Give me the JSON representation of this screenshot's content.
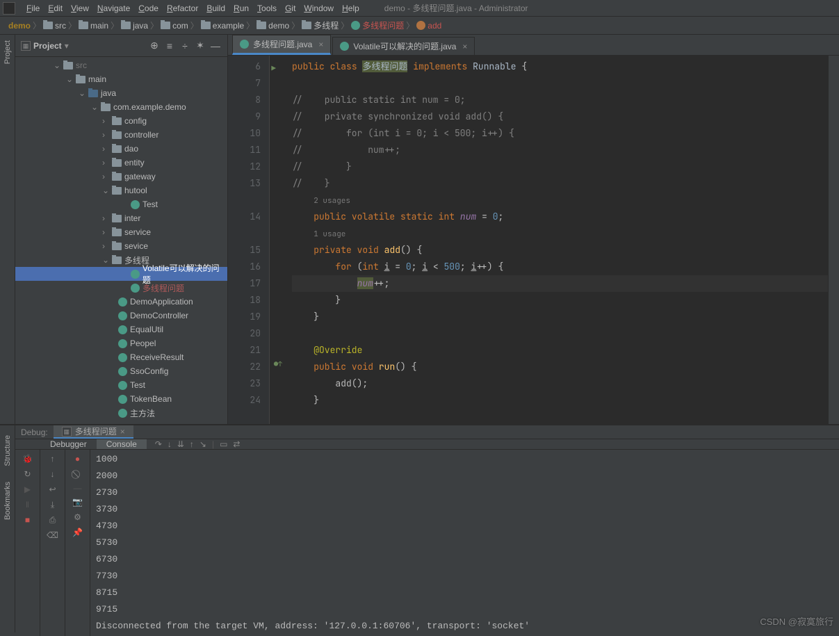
{
  "window_title": "demo - 多线程问题.java - Administrator",
  "menu": [
    "File",
    "Edit",
    "View",
    "Navigate",
    "Code",
    "Refactor",
    "Build",
    "Run",
    "Tools",
    "Git",
    "Window",
    "Help"
  ],
  "breadcrumbs": [
    {
      "label": "demo",
      "kind": "root"
    },
    {
      "label": "src",
      "kind": "folder"
    },
    {
      "label": "main",
      "kind": "folder"
    },
    {
      "label": "java",
      "kind": "folder"
    },
    {
      "label": "com",
      "kind": "folder"
    },
    {
      "label": "example",
      "kind": "folder"
    },
    {
      "label": "demo",
      "kind": "folder"
    },
    {
      "label": "多线程",
      "kind": "folder"
    },
    {
      "label": "多线程问题",
      "kind": "class"
    },
    {
      "label": "add",
      "kind": "method"
    }
  ],
  "project_header": "Project",
  "left_stripe_label": "Project",
  "tree": [
    {
      "indent": 55,
      "chev": "v",
      "icon": "folder",
      "label": "src",
      "dim": true
    },
    {
      "indent": 73,
      "chev": "v",
      "icon": "folder",
      "label": "main"
    },
    {
      "indent": 91,
      "chev": "v",
      "icon": "folder-blue",
      "label": "java"
    },
    {
      "indent": 109,
      "chev": "v",
      "icon": "folder",
      "label": "com.example.demo"
    },
    {
      "indent": 125,
      "chev": ">",
      "icon": "folder",
      "label": "config"
    },
    {
      "indent": 125,
      "chev": ">",
      "icon": "folder",
      "label": "controller"
    },
    {
      "indent": 125,
      "chev": ">",
      "icon": "folder",
      "label": "dao"
    },
    {
      "indent": 125,
      "chev": ">",
      "icon": "folder",
      "label": "entity"
    },
    {
      "indent": 125,
      "chev": ">",
      "icon": "folder",
      "label": "gateway"
    },
    {
      "indent": 125,
      "chev": "v",
      "icon": "folder",
      "label": "hutool"
    },
    {
      "indent": 152,
      "chev": "",
      "icon": "java",
      "label": "Test"
    },
    {
      "indent": 125,
      "chev": ">",
      "icon": "folder",
      "label": "inter"
    },
    {
      "indent": 125,
      "chev": ">",
      "icon": "folder",
      "label": "service"
    },
    {
      "indent": 125,
      "chev": ">",
      "icon": "folder",
      "label": "sevice"
    },
    {
      "indent": 125,
      "chev": "v",
      "icon": "folder",
      "label": "多线程"
    },
    {
      "indent": 152,
      "chev": "",
      "icon": "java",
      "label": "Volatile可以解决的问题",
      "selected": true
    },
    {
      "indent": 152,
      "chev": "",
      "icon": "java",
      "label": "多线程问题",
      "excluded": true
    },
    {
      "indent": 134,
      "chev": "",
      "icon": "java",
      "label": "DemoApplication"
    },
    {
      "indent": 134,
      "chev": "",
      "icon": "java",
      "label": "DemoController"
    },
    {
      "indent": 134,
      "chev": "",
      "icon": "java",
      "label": "EqualUtil"
    },
    {
      "indent": 134,
      "chev": "",
      "icon": "java",
      "label": "Peopel"
    },
    {
      "indent": 134,
      "chev": "",
      "icon": "java",
      "label": "ReceiveResult"
    },
    {
      "indent": 134,
      "chev": "",
      "icon": "java",
      "label": "SsoConfig"
    },
    {
      "indent": 134,
      "chev": "",
      "icon": "java",
      "label": "Test"
    },
    {
      "indent": 134,
      "chev": "",
      "icon": "java",
      "label": "TokenBean"
    },
    {
      "indent": 134,
      "chev": "",
      "icon": "java",
      "label": "主方法"
    }
  ],
  "tabs": [
    {
      "label": "多线程问题.java",
      "active": true
    },
    {
      "label": "Volatile可以解决的问题.java",
      "active": false
    }
  ],
  "gutter_start": 6,
  "code_lines": [
    {
      "n": 6,
      "run": true,
      "html": "<span class='kw'>public</span> <span class='kw'>class</span> <span class='hilite cls'>多线程问题</span> <span class='kw'>implements</span> <span class='cls'>Runnable</span> {"
    },
    {
      "n": 7,
      "html": ""
    },
    {
      "n": 8,
      "html": "<span class='com'>//    public static int num = 0;</span>"
    },
    {
      "n": 9,
      "html": "<span class='com'>//    private synchronized void add() {</span>"
    },
    {
      "n": 10,
      "html": "<span class='com'>//        for (int i = 0; i < 500; i++) {</span>"
    },
    {
      "n": 11,
      "html": "<span class='com'>//            num++;</span>"
    },
    {
      "n": 12,
      "html": "<span class='com'>//        }</span>"
    },
    {
      "n": 13,
      "html": "<span class='com'>//    }</span>"
    },
    {
      "n": 0,
      "inlay": "2 usages"
    },
    {
      "n": 14,
      "html": "    <span class='kw'>public</span> <span class='kw'>volatile</span> <span class='kw'>static</span> <span class='kw'>int</span> <span class='ident'>num</span> = <span class='num'>0</span>;"
    },
    {
      "n": 0,
      "inlay": "1 usage"
    },
    {
      "n": 15,
      "html": "    <span class='kw'>private</span> <span class='kw'>void</span> <span class='fn'>add</span>() {"
    },
    {
      "n": 16,
      "html": "        <span class='kw'>for</span> (<span class='kw'>int</span> <u>i</u> = <span class='num'>0</span>; <u>i</u> &lt; <span class='num'>500</span>; <u>i</u>++) {"
    },
    {
      "n": 17,
      "cur": true,
      "html": "            <span class='hilite ident'>num</span>++;"
    },
    {
      "n": 18,
      "html": "        }"
    },
    {
      "n": 19,
      "html": "    }"
    },
    {
      "n": 20,
      "html": ""
    },
    {
      "n": 21,
      "html": "    <span class='anno'>@Override</span>"
    },
    {
      "n": 22,
      "impl": true,
      "html": "    <span class='kw'>public</span> <span class='kw'>void</span> <span class='fn'>run</span>() {"
    },
    {
      "n": 23,
      "html": "        add();"
    },
    {
      "n": 24,
      "html": "    }"
    }
  ],
  "debug": {
    "label": "Debug:",
    "run_config": "多线程问题",
    "subtabs": [
      "Debugger",
      "Console"
    ],
    "active_subtab": "Console",
    "output": [
      "1000",
      "2000",
      "2730",
      "3730",
      "4730",
      "5730",
      "6730",
      "7730",
      "8715",
      "9715",
      "Disconnected from the target VM, address: '127.0.0.1:60706', transport: 'socket'"
    ]
  },
  "sidebar_bottom_labels": [
    "Structure",
    "Bookmarks"
  ],
  "watermark": "CSDN @寂寞旅行"
}
